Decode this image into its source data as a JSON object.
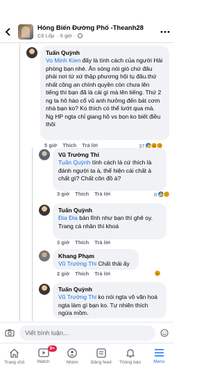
{
  "header": {
    "title": "Hóng Biến Đường Phố -Theanh28",
    "author": "Cô Lốp",
    "time": "6 giờ"
  },
  "comments": [
    {
      "name": "Tuấn Quỳnh",
      "mention": "Vo Minh Kien",
      "text": " đấy là tính cách của người Hải phòng bạn nhé. Ăn sóng nói gió chứ đâu phải nơi tứ xứ thập phương hội tụ đâu.thứ nhất công an chính quyền còn chưa lên tiếng thì bạn đã là cái gì mà lên tiếng. Thứ 2 ng ta hô hào cổ vũ anh hưởng đến bát cơm nhà bạn ko? Ko thích có thể lướt qua mà. Ng HP ngta chỉ giang hồ vs bọn ko biết điều thôi",
      "time": "5 giờ",
      "like": "Thích",
      "reply": "Trả lời",
      "reactions": "37"
    },
    {
      "name": "Vũ Trường Thi",
      "mention": "Tuấn Quỳnh",
      "text": " tính cách là cứ thích là đánh người ta à, thể hiện cái chất à chất gì? Chất côn đồ à?",
      "time": "3 giờ",
      "like": "Thích",
      "reply": "Trả lời",
      "reactions": "8"
    },
    {
      "name": "Tuấn Quỳnh",
      "mention": "Đia Đia",
      "text": " bản lĩnh như bạn thì ghê oy. Trang cá nhân thì khoá",
      "time": "3 giờ",
      "like": "Thích",
      "reply": "Trả lời",
      "reactions": ""
    },
    {
      "name": "Khang Phạm",
      "mention": "Vũ Trường Thi",
      "text": " Chất thải ấy",
      "time": "2 giờ",
      "like": "Thích",
      "reply": "Trả lời",
      "reactions": ""
    },
    {
      "name": "Tuấn Quỳnh",
      "mention": "Vũ Trường Thi",
      "text": " ko nói ngta vô văn hoá ngta làm gì bạn ko. Tự nhiên thích ngứa mồm.",
      "time": "",
      "like": "",
      "reply": "",
      "reactions": ""
    }
  ],
  "composer": {
    "placeholder": "Viết bình luận..."
  },
  "tabs": [
    {
      "label": "Trang chủ",
      "icon": "home-icon"
    },
    {
      "label": "Watch",
      "icon": "watch-icon",
      "badge": "9+"
    },
    {
      "label": "Nhóm",
      "icon": "groups-icon"
    },
    {
      "label": "Bảng feed",
      "icon": "feeds-icon"
    },
    {
      "label": "Thông báo",
      "icon": "bell-icon"
    },
    {
      "label": "Menu",
      "icon": "menu-icon"
    }
  ],
  "colors": {
    "accent": "#1877f2",
    "mention": "#1b74e4",
    "bubble": "#f0f2f5"
  }
}
